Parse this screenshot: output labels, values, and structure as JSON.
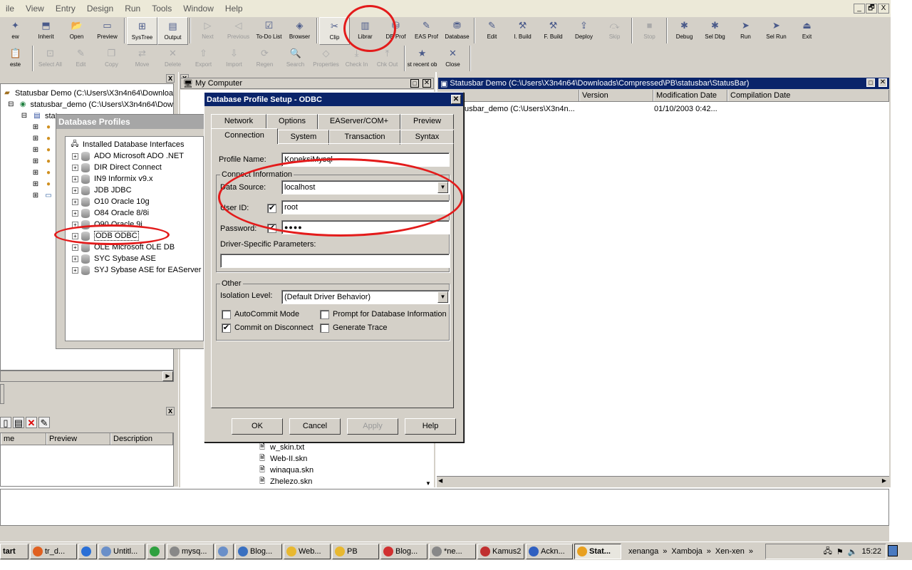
{
  "menu": [
    "ile",
    "View",
    "Entry",
    "Design",
    "Run",
    "Tools",
    "Window",
    "Help"
  ],
  "window_buttons": [
    "_",
    "🗗",
    "X"
  ],
  "toolbar1": [
    {
      "label": "ew",
      "icon": "new-icon",
      "disabled": false
    },
    {
      "label": "Inherit",
      "icon": "inherit-icon",
      "disabled": false
    },
    {
      "label": "Open",
      "icon": "open-icon",
      "disabled": false
    },
    {
      "label": "Preview",
      "icon": "preview-icon",
      "disabled": false
    },
    {
      "label": "SysTree",
      "icon": "systree-icon",
      "disabled": false,
      "pressed": true
    },
    {
      "label": "Output",
      "icon": "output-icon",
      "disabled": false,
      "pressed": true
    },
    {
      "label": "Next",
      "icon": "next-icon",
      "disabled": true
    },
    {
      "label": "Previous",
      "icon": "previous-icon",
      "disabled": true
    },
    {
      "label": "To-Do List",
      "icon": "todo-icon",
      "disabled": false
    },
    {
      "label": "Browser",
      "icon": "browser-icon",
      "disabled": false
    },
    {
      "label": "Clip",
      "icon": "clip-icon",
      "disabled": false,
      "pressed": true
    },
    {
      "label": "Librar",
      "icon": "library-icon",
      "disabled": false
    },
    {
      "label": "DB Prof",
      "icon": "db-profile-icon",
      "disabled": false
    },
    {
      "label": "EAS Prof",
      "icon": "eas-profile-icon",
      "disabled": false
    },
    {
      "label": "Database",
      "icon": "database-icon",
      "disabled": false
    },
    {
      "label": "Edit",
      "icon": "edit-icon",
      "disabled": false
    },
    {
      "label": "I. Build",
      "icon": "incremental-build-icon",
      "disabled": false
    },
    {
      "label": "F. Build",
      "icon": "full-build-icon",
      "disabled": false
    },
    {
      "label": "Deploy",
      "icon": "deploy-icon",
      "disabled": false
    },
    {
      "label": "Skip",
      "icon": "skip-icon",
      "disabled": true
    },
    {
      "label": "Stop",
      "icon": "stop-icon",
      "disabled": true
    },
    {
      "label": "Debug",
      "icon": "debug-icon",
      "disabled": false
    },
    {
      "label": "Sel Dbg",
      "icon": "select-debug-icon",
      "disabled": false
    },
    {
      "label": "Run",
      "icon": "run-icon",
      "disabled": false
    },
    {
      "label": "Sel Run",
      "icon": "select-run-icon",
      "disabled": false
    },
    {
      "label": "Exit",
      "icon": "exit-icon",
      "disabled": false
    }
  ],
  "toolbar2": [
    {
      "label": "este",
      "icon": "paste-icon",
      "disabled": false
    },
    {
      "label": "Select All",
      "icon": "select-all-icon",
      "disabled": true
    },
    {
      "label": "Edit",
      "icon": "edit-icon",
      "disabled": true
    },
    {
      "label": "Copy",
      "icon": "copy-icon",
      "disabled": true
    },
    {
      "label": "Move",
      "icon": "move-icon",
      "disabled": true
    },
    {
      "label": "Delete",
      "icon": "delete-icon",
      "disabled": true
    },
    {
      "label": "Export",
      "icon": "export-icon",
      "disabled": true
    },
    {
      "label": "Import",
      "icon": "import-icon",
      "disabled": true
    },
    {
      "label": "Regen",
      "icon": "regen-icon",
      "disabled": true
    },
    {
      "label": "Search",
      "icon": "search-icon",
      "disabled": true
    },
    {
      "label": "Properties",
      "icon": "properties-icon",
      "disabled": true
    },
    {
      "label": "Check In",
      "icon": "check-in-icon",
      "disabled": true
    },
    {
      "label": "Chk Out",
      "icon": "check-out-icon",
      "disabled": true
    },
    {
      "label": "st recent ob",
      "icon": "recent-object-icon",
      "disabled": false
    },
    {
      "label": "Close",
      "icon": "close-icon",
      "disabled": false
    }
  ],
  "systree": {
    "items": [
      "Statusbar Demo (C:\\Users\\X3n4n64\\Downloa",
      "statusbar_demo (C:\\Users\\X3n4n64\\Dow",
      "statu"
    ]
  },
  "bottom_left": {
    "columns": [
      "me",
      "Preview",
      "Description"
    ]
  },
  "my_computer": {
    "title": "My Computer",
    "files": [
      "w_skin.txt",
      "Web-II.skn",
      "winaqua.skn",
      "Zhelezo.skn"
    ]
  },
  "statusbar_window": {
    "title": "Statusbar Demo (C:\\Users\\X3n4n64\\Downloads\\Compressed\\PB\\statusbar\\StatusBar)",
    "columns": [
      "",
      "Version",
      "Modification Date",
      "Compilation Date"
    ],
    "rows": [
      [
        "tusbar_demo (C:\\Users\\X3n4n...",
        "",
        "01/10/2003 0:42...",
        ""
      ]
    ]
  },
  "db_profiles": {
    "title": "Database Profiles",
    "root": "Installed Database Interfaces",
    "items": [
      "ADO Microsoft ADO .NET",
      "DIR Direct Connect",
      "IN9 Informix v9.x",
      "JDB JDBC",
      "O10 Oracle 10g",
      "O84 Oracle 8/8i",
      "O90 Oracle 9i",
      "ODB ODBC",
      "OLE Microsoft OLE DB",
      "SYC Sybase ASE",
      "SYJ Sybase ASE for EAServer"
    ]
  },
  "dialog": {
    "title": "Database Profile Setup - ODBC",
    "tabs_row1": [
      "Network",
      "Options",
      "EAServer/COM+",
      "Preview"
    ],
    "tabs_row2": [
      "Connection",
      "System",
      "Transaction",
      "Syntax"
    ],
    "profile_name_label": "Profile Name:",
    "profile_name": "KoneksiMysql",
    "connect_group": "Connect Information",
    "data_source_label": "Data Source:",
    "data_source": "localhost",
    "user_id_label": "User ID:",
    "user_id": "root",
    "password_label": "Password:",
    "password": "●●●●",
    "driver_params_label": "Driver-Specific Parameters:",
    "driver_params": "",
    "other_group": "Other",
    "isolation_label": "Isolation Level:",
    "isolation": "(Default Driver Behavior)",
    "autocommit": "AutoCommit Mode",
    "prompt_db": "Prompt for Database Information",
    "commit_disconnect": "Commit on Disconnect",
    "generate_trace": "Generate Trace",
    "ok": "OK",
    "cancel": "Cancel",
    "apply": "Apply",
    "help": "Help"
  },
  "taskbar": {
    "start": "tart",
    "tasks": [
      {
        "label": "tr_d...",
        "color": "#e06020"
      },
      {
        "label": "",
        "color": "#2a6fd6"
      },
      {
        "label": "Untitl...",
        "color": "#6a8fc8"
      },
      {
        "label": "",
        "color": "#2fa040"
      },
      {
        "label": "mysq...",
        "color": "#888888"
      },
      {
        "label": "",
        "color": "#6a8fc8"
      },
      {
        "label": "Blog...",
        "color": "#3a70c0"
      },
      {
        "label": "Web...",
        "color": "#e8b830"
      },
      {
        "label": "PB",
        "color": "#e8b830"
      },
      {
        "label": "Blog...",
        "color": "#d03030"
      },
      {
        "label": "*ne...",
        "color": "#888888"
      },
      {
        "label": "Kamus2",
        "color": "#c03030"
      },
      {
        "label": "Ackn...",
        "color": "#3060c0"
      },
      {
        "label": "Stat...",
        "color": "#e8a020",
        "active": true
      }
    ],
    "quick": [
      "xenanga",
      "»",
      "Xamboja",
      "»",
      "Xen-xen",
      "»"
    ],
    "clock": "15:22"
  },
  "annotation_color": "#e31b1b"
}
